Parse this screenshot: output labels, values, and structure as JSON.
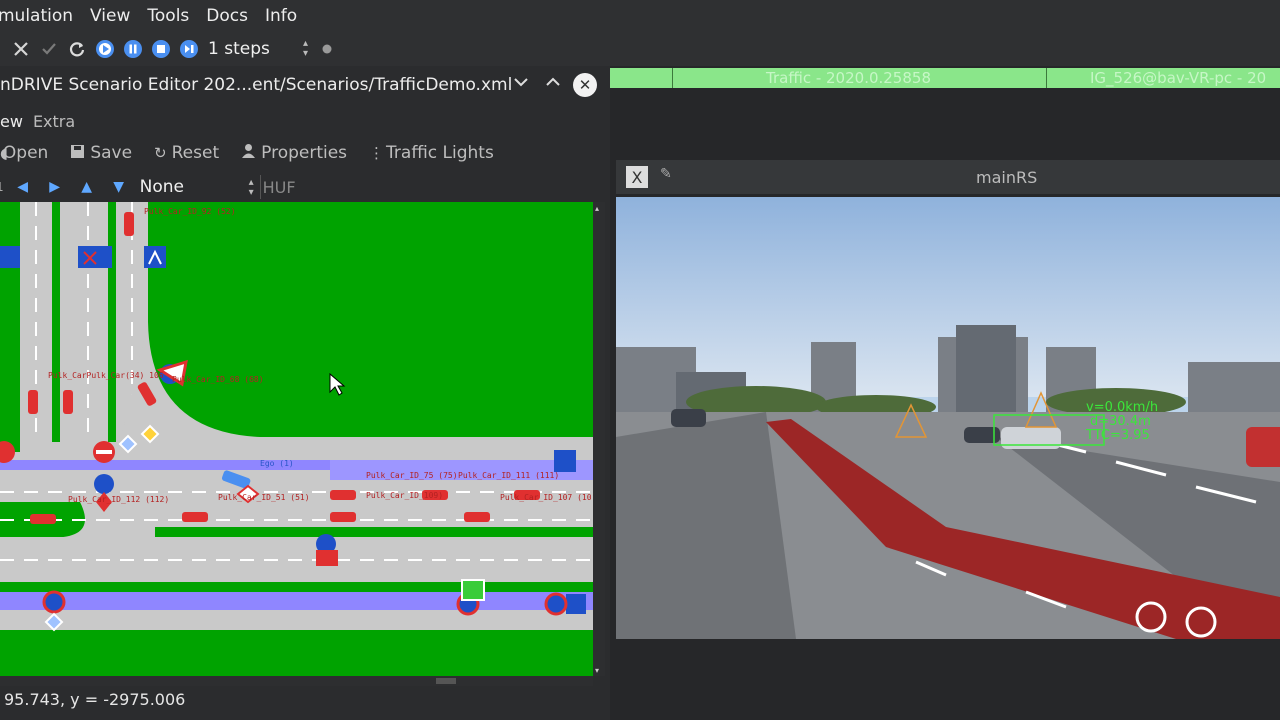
{
  "menubar": {
    "items": [
      "mulation",
      "View",
      "Tools",
      "Docs",
      "Info"
    ]
  },
  "toolbar": {
    "icons": [
      "tools-icon",
      "check-icon",
      "refresh-icon",
      "play-icon",
      "pause-icon",
      "stop-icon",
      "step-icon",
      "record-dot-icon"
    ],
    "steps_value": "1 steps"
  },
  "editor": {
    "title": "nDRIVE Scenario Editor 202...ent/Scenarios/TrafficDemo.xml",
    "menu": [
      "ew",
      "Extra"
    ],
    "tools": {
      "open": "Open",
      "save": "Save",
      "reset": "Reset",
      "properties": "Properties",
      "traffic_lights": "Traffic Lights"
    },
    "nav": {
      "index": "1",
      "select_value": "None",
      "huf": "HUF"
    },
    "map_labels": {
      "car52": "Pulk_Car_ID_92 (52)",
      "car_group": "Pulk_CarPulk_Car(34) 106",
      "car68": "Pulk_Car_ID_68 (68)",
      "ego": "Ego (1)",
      "car75": "Pulk_Car_ID_75 (75)",
      "car111": "Pulk_Car_ID_111 (111)",
      "car112": "Pulk_Car_ID_112 (112)",
      "car51": "Pulk_Car_ID_51 (51)",
      "car109": "Pulk_Car_ID_109)",
      "car107": "Pulk_Car_ID_107 (10"
    },
    "coords": "95.743, y = -2975.006"
  },
  "traffic_bar": {
    "left": "Traffic - 2020.0.25858",
    "right": "IG_526@bav-VR-pc - 20"
  },
  "render": {
    "title": "mainRS",
    "hud": [
      "v=0.0km/h",
      "d=30.4m",
      "TTC=3.95"
    ]
  },
  "colors": {
    "grass": "#00a300",
    "road": "#c9c9c9",
    "lane_blue": "#8f86ff",
    "accent": "#4a8ff0"
  }
}
